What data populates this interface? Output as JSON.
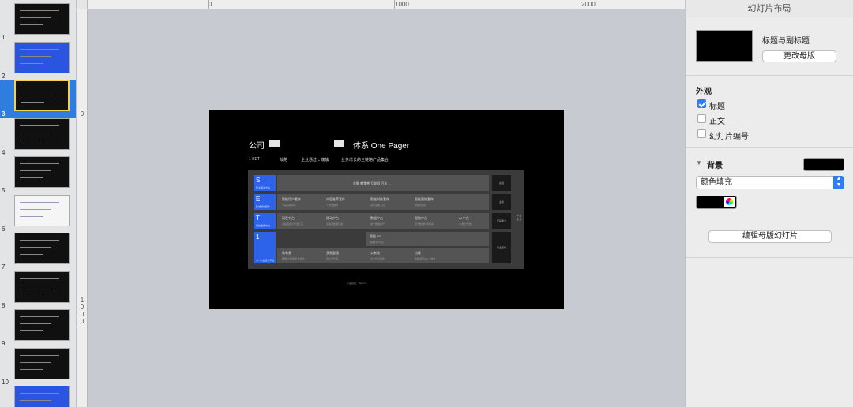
{
  "thumbnails": [
    {
      "number": "1",
      "style": "dark",
      "selected": false
    },
    {
      "number": "2",
      "style": "blue",
      "selected": false
    },
    {
      "number": "3",
      "style": "dark",
      "selected": true
    },
    {
      "number": "4",
      "style": "dark",
      "selected": false
    },
    {
      "number": "5",
      "style": "dark",
      "selected": false
    },
    {
      "number": "6",
      "style": "white",
      "selected": false
    },
    {
      "number": "7",
      "style": "dark",
      "selected": false
    },
    {
      "number": "8",
      "style": "dark",
      "selected": false
    },
    {
      "number": "9",
      "style": "dark",
      "selected": false
    },
    {
      "number": "10",
      "style": "dark",
      "selected": false
    },
    {
      "number": "",
      "style": "blue",
      "selected": false
    }
  ],
  "ruler": {
    "h_labels": [
      "0",
      "1000",
      "2000"
    ],
    "v_labels": [
      "0",
      "1\n0\n0\n0"
    ]
  },
  "slide": {
    "title_prefix": "公司",
    "title_suffix": "体系 One Pager",
    "nav": [
      "1 SET -",
      "战略",
      "企业通过 c 端触",
      "业务增长的全链路产品集合"
    ],
    "rows": [
      {
        "label": "S",
        "sub": "行业解决方案"
      },
      {
        "label": "E",
        "sub": "私域增长套件"
      },
      {
        "label": "T",
        "sub": "增长数据中台"
      },
      {
        "label": "1",
        "sub": "Ai - 中台能力平台"
      }
    ],
    "row1_text": "金融   教零售   互联网   汽车   ...",
    "row2": [
      {
        "t": "智能用户套件",
        "s": "产品营销增长"
      },
      {
        "t": "内容推荐套件",
        "s": "个性化推荐"
      },
      {
        "t": "智能科技套件",
        "s": "运营决策工具"
      },
      {
        "t": "智能营销套件",
        "s": "营销自动化"
      }
    ],
    "row3": [
      {
        "t": "研发中台",
        "s": "全链路用户开发工具"
      },
      {
        "t": "移动中台",
        "s": "全渠道数据打通"
      },
      {
        "t": "数据中台",
        "s": "统一数据资产"
      },
      {
        "t": "智脑中台",
        "s": "基于数据科学驱动"
      },
      {
        "t": "AI 中台",
        "s": "AI 能力开放"
      }
    ],
    "row4_top": {
      "t": "智能 DS",
      "s": "数据科学平台"
    },
    "row4": [
      {
        "t": "私有云",
        "s": "数据/大模型/安全技术"
      },
      {
        "t": "多云管理",
        "s": "混合云管理"
      },
      {
        "t": "公有云",
        "s": "全方位云服务"
      },
      {
        "t": "边缘",
        "s": "数据/算力/AI 一体化"
      }
    ],
    "side": [
      "总结",
      "业务",
      "产品能力",
      "行业落地"
    ],
    "side_vertical": "中 台 能 力",
    "footer": "产品链接：https://..."
  },
  "inspector": {
    "header": "幻灯片布局",
    "master_name": "标题与副标题",
    "change_master": "更改母版",
    "appearance_title": "外观",
    "checks": [
      {
        "label": "标题",
        "checked": true
      },
      {
        "label": "正文",
        "checked": false
      },
      {
        "label": "幻灯片编号",
        "checked": false
      }
    ],
    "background_title": "背景",
    "background_toggle": "▼",
    "fill_type": "颜色填充",
    "fill_color": "#000000",
    "edit_master": "编辑母版幻灯片"
  }
}
